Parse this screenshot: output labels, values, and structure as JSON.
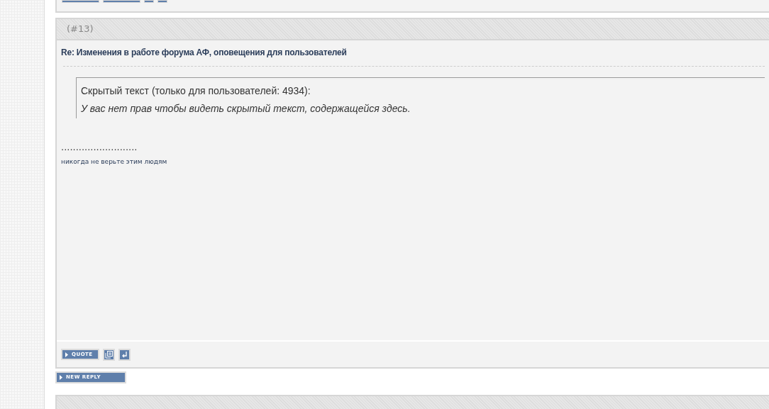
{
  "post": {
    "number": "(#13)",
    "title": "Re: Изменения в работе форума АФ, оповещения для пользователей",
    "hidden_block": {
      "label": "Скрытый текст (только для пользователей: 4934):",
      "message": "У вас нет прав чтобы видеть скрытый текст, содержащейся здесь."
    },
    "signature": {
      "dots": "..........................",
      "text": "никогда не верьте этим людям"
    },
    "quote_button": "QUOTE"
  },
  "new_reply_button": "NEW REPLY"
}
